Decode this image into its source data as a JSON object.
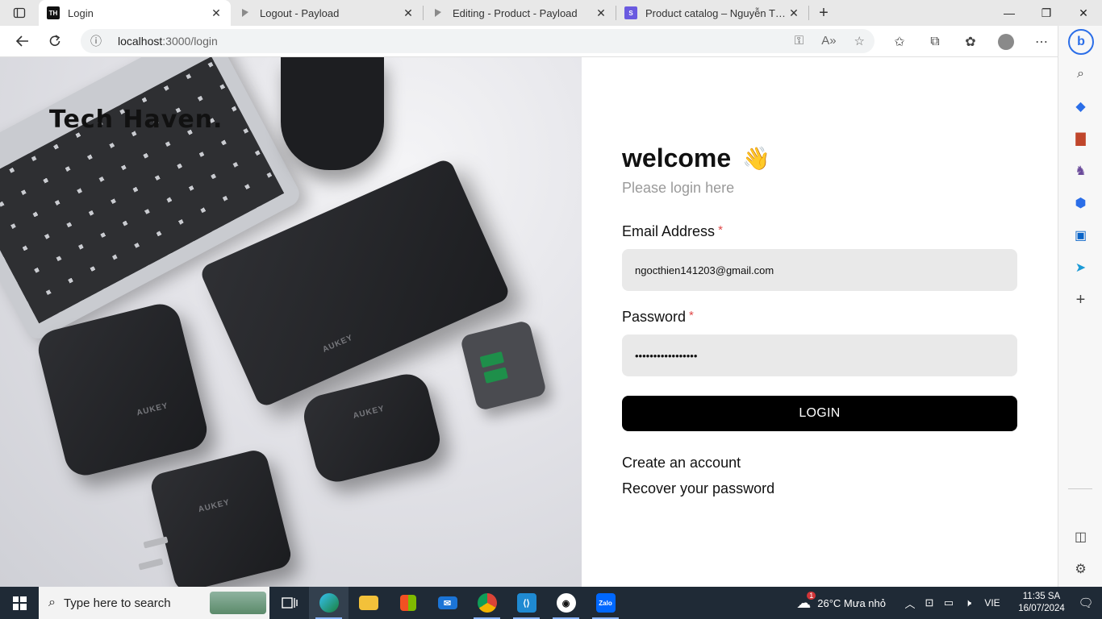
{
  "browser": {
    "tabs": [
      {
        "title": "Login",
        "favicon": "TH",
        "favicon_bg": "#111111",
        "favicon_fg": "#ffffff",
        "active": true
      },
      {
        "title": "Logout - Payload",
        "favicon": "payload-icon",
        "active": false
      },
      {
        "title": "Editing - Product - Payload",
        "favicon": "payload-icon",
        "active": false
      },
      {
        "title": "Product catalog – Nguyễn Thiện",
        "favicon": "S",
        "favicon_bg": "#6a5ae0",
        "favicon_fg": "#ffffff",
        "active": false
      }
    ],
    "address": {
      "host": "localhost",
      "path": ":3000/login"
    }
  },
  "page": {
    "brand": "Tech Haven.",
    "welcome": "welcome",
    "wave": "👋",
    "subtitle": "Please login here",
    "email_label": "Email Address",
    "email_value": "ngocthien141203@gmail.com",
    "password_label": "Password",
    "password_value": "•••••••••••••••••",
    "required_mark": "*",
    "login_label": "LOGIN",
    "create_account": "Create an account",
    "recover_password": "Recover your password"
  },
  "taskbar": {
    "search_placeholder": "Type here to search",
    "weather": "26°C  Mưa nhỏ",
    "weather_badge": "1",
    "language": "VIE",
    "time": "11:35 SA",
    "date": "16/07/2024"
  },
  "colors": {
    "accent_black": "#000000",
    "required_red": "#e04848",
    "input_bg": "#e9e9e9",
    "taskbar_bg": "#1f2a36"
  }
}
